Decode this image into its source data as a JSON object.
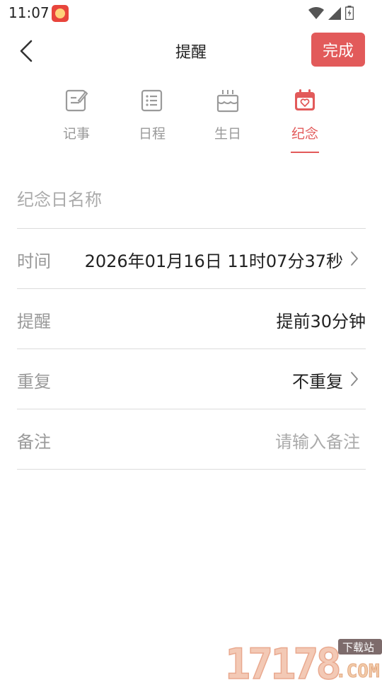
{
  "status_bar": {
    "time": "11:07",
    "icons": [
      "app-notification-icon",
      "wifi-icon",
      "signal-icon",
      "battery-icon"
    ]
  },
  "header": {
    "title": "提醒",
    "done_label": "完成"
  },
  "tabs": [
    {
      "label": "记事",
      "icon": "note-icon",
      "active": false
    },
    {
      "label": "日程",
      "icon": "schedule-list-icon",
      "active": false
    },
    {
      "label": "生日",
      "icon": "birthday-cake-icon",
      "active": false
    },
    {
      "label": "纪念",
      "icon": "calendar-heart-icon",
      "active": true
    }
  ],
  "form": {
    "name_placeholder": "纪念日名称",
    "time": {
      "label": "时间",
      "value": "2026年01月16日 11时07分37秒"
    },
    "reminder": {
      "label": "提醒",
      "value": "提前30分钟"
    },
    "repeat": {
      "label": "重复",
      "value": "不重复"
    },
    "note": {
      "label": "备注",
      "placeholder": "请输入备注"
    }
  },
  "watermark": {
    "text": "17178",
    "site": ".COM",
    "tag": "下载站"
  },
  "colors": {
    "accent": "#e25a5a",
    "label_gray": "#999999",
    "divider": "#dcdcdc"
  }
}
